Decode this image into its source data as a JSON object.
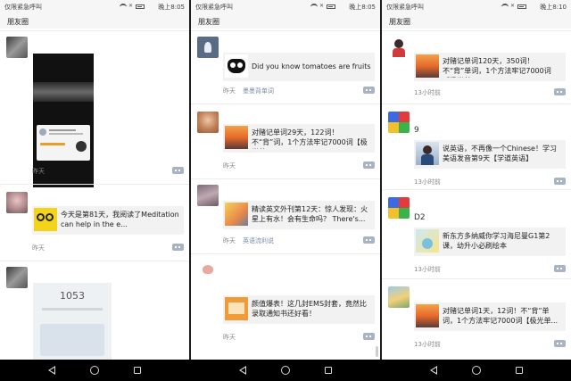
{
  "status": {
    "left_text": "仅限紧急呼叫",
    "panels": [
      {
        "time": "晚上8:05"
      },
      {
        "time": "晚上8:05"
      },
      {
        "time": "晚上8:10"
      }
    ]
  },
  "title": "朋友圈",
  "panel1": {
    "posts": [
      {
        "video_caption": "",
        "time": "昨天"
      },
      {
        "text": "今天是第81天，我阅读了Meditation can help in the e...",
        "thumb_label": "",
        "time": "昨天"
      },
      {
        "screen_number": "1053"
      }
    ]
  },
  "panel2": {
    "posts": [
      {
        "text": "Did you know tomatoes are fruits?",
        "time": "昨天",
        "source": "墨墨背单词"
      },
      {
        "text": "对赌记单词29天，122词！不“背”词，1个方法牢记7000词【极光单...",
        "time": "昨天"
      },
      {
        "text": "精读英文外刊第12天：惊人发现：火星上有水！会有生命吗？ There's...",
        "time": "昨天",
        "source": "英语流利说"
      },
      {
        "text": "颜值爆表！这几封EMS封套，竟然比录取通知书还好看！",
        "time": "昨天"
      }
    ]
  },
  "panel3": {
    "posts": [
      {
        "text": "对赌记单词120天，350词！不“背”单词，1个方法牢记7000词【极光单...",
        "time": "13小时前"
      },
      {
        "name": "9",
        "text": "说英语，不再像一个Chinese！学习美语发音第9天【学道英语】",
        "time": "13小时前"
      },
      {
        "name": "D2",
        "text": "新东方多纳威你学习海尼曼G1第2课，幼升小必刷绘本",
        "time": "13小时前"
      },
      {
        "text": "对赌记单词1天，12词！不“背”单词，1个方法牢记7000词【极光单...",
        "time": "13小时前"
      }
    ]
  },
  "colors": {
    "comment_button": "#a9b3c6",
    "card_bg": "#f2f2f2",
    "titlebar_bg": "#f6f6f6",
    "navbar_bg": "#000000"
  }
}
